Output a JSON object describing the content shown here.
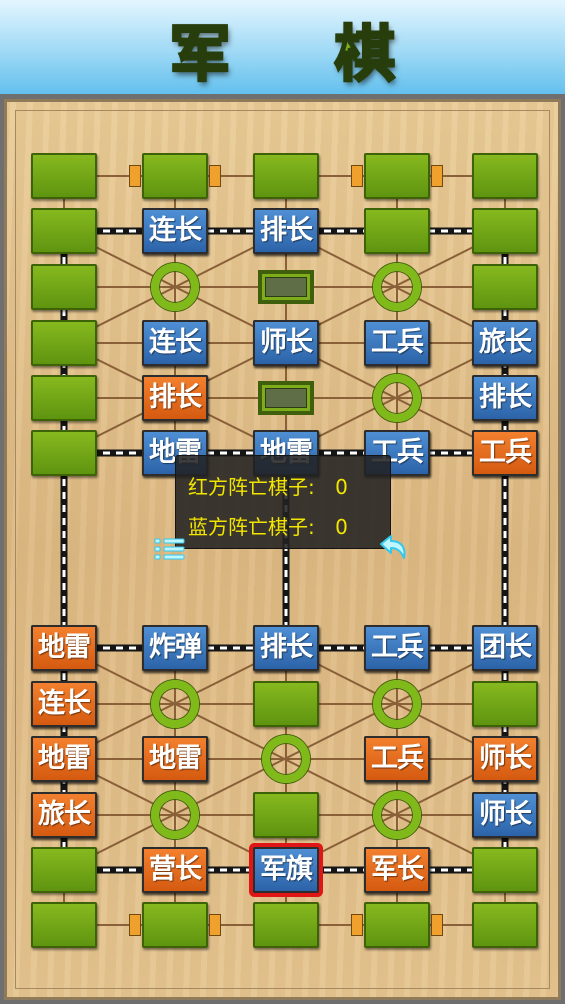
{
  "header": {
    "title": "军 棋"
  },
  "info_panel": {
    "red_label": "红方阵亡棋子:",
    "red_count": "0",
    "blue_label": "蓝方阵亡棋子:",
    "blue_count": "0"
  },
  "icons": {
    "menu": "menu-list-icon",
    "back": "undo-arrow-icon"
  },
  "colors": {
    "blue_piece": "#2f6db5",
    "orange_piece": "#e2661c",
    "post": "#6fa514",
    "selection": "#e01515",
    "info_text": "#f2e600"
  },
  "pieces": [
    {
      "side": "blue",
      "label": "连长",
      "col": 1,
      "row": 1
    },
    {
      "side": "blue",
      "label": "排长",
      "col": 2,
      "row": 1
    },
    {
      "side": "blue",
      "label": "连长",
      "col": 1,
      "row": 3
    },
    {
      "side": "blue",
      "label": "师长",
      "col": 2,
      "row": 3
    },
    {
      "side": "blue",
      "label": "工兵",
      "col": 3,
      "row": 3
    },
    {
      "side": "blue",
      "label": "旅长",
      "col": 4,
      "row": 3
    },
    {
      "side": "orange",
      "label": "排长",
      "col": 1,
      "row": 4
    },
    {
      "side": "blue",
      "label": "排长",
      "col": 4,
      "row": 4
    },
    {
      "side": "blue",
      "label": "地雷",
      "col": 1,
      "row": 5
    },
    {
      "side": "blue",
      "label": "地雷",
      "col": 2,
      "row": 5
    },
    {
      "side": "blue",
      "label": "工兵",
      "col": 3,
      "row": 5
    },
    {
      "side": "orange",
      "label": "工兵",
      "col": 4,
      "row": 5
    },
    {
      "side": "orange",
      "label": "地雷",
      "col": 0,
      "row": 6
    },
    {
      "side": "blue",
      "label": "炸弹",
      "col": 1,
      "row": 6
    },
    {
      "side": "blue",
      "label": "排长",
      "col": 2,
      "row": 6
    },
    {
      "side": "blue",
      "label": "工兵",
      "col": 3,
      "row": 6
    },
    {
      "side": "blue",
      "label": "团长",
      "col": 4,
      "row": 6
    },
    {
      "side": "orange",
      "label": "连长",
      "col": 0,
      "row": 7
    },
    {
      "side": "orange",
      "label": "地雷",
      "col": 0,
      "row": 8
    },
    {
      "side": "orange",
      "label": "地雷",
      "col": 1,
      "row": 8
    },
    {
      "side": "orange",
      "label": "工兵",
      "col": 3,
      "row": 8
    },
    {
      "side": "orange",
      "label": "师长",
      "col": 4,
      "row": 8
    },
    {
      "side": "orange",
      "label": "旅长",
      "col": 0,
      "row": 9
    },
    {
      "side": "blue",
      "label": "师长",
      "col": 4,
      "row": 9
    },
    {
      "side": "orange",
      "label": "营长",
      "col": 1,
      "row": 10
    },
    {
      "side": "blue",
      "label": "军旗",
      "col": 2,
      "row": 10,
      "selected": true
    },
    {
      "side": "orange",
      "label": "军长",
      "col": 3,
      "row": 10
    }
  ]
}
